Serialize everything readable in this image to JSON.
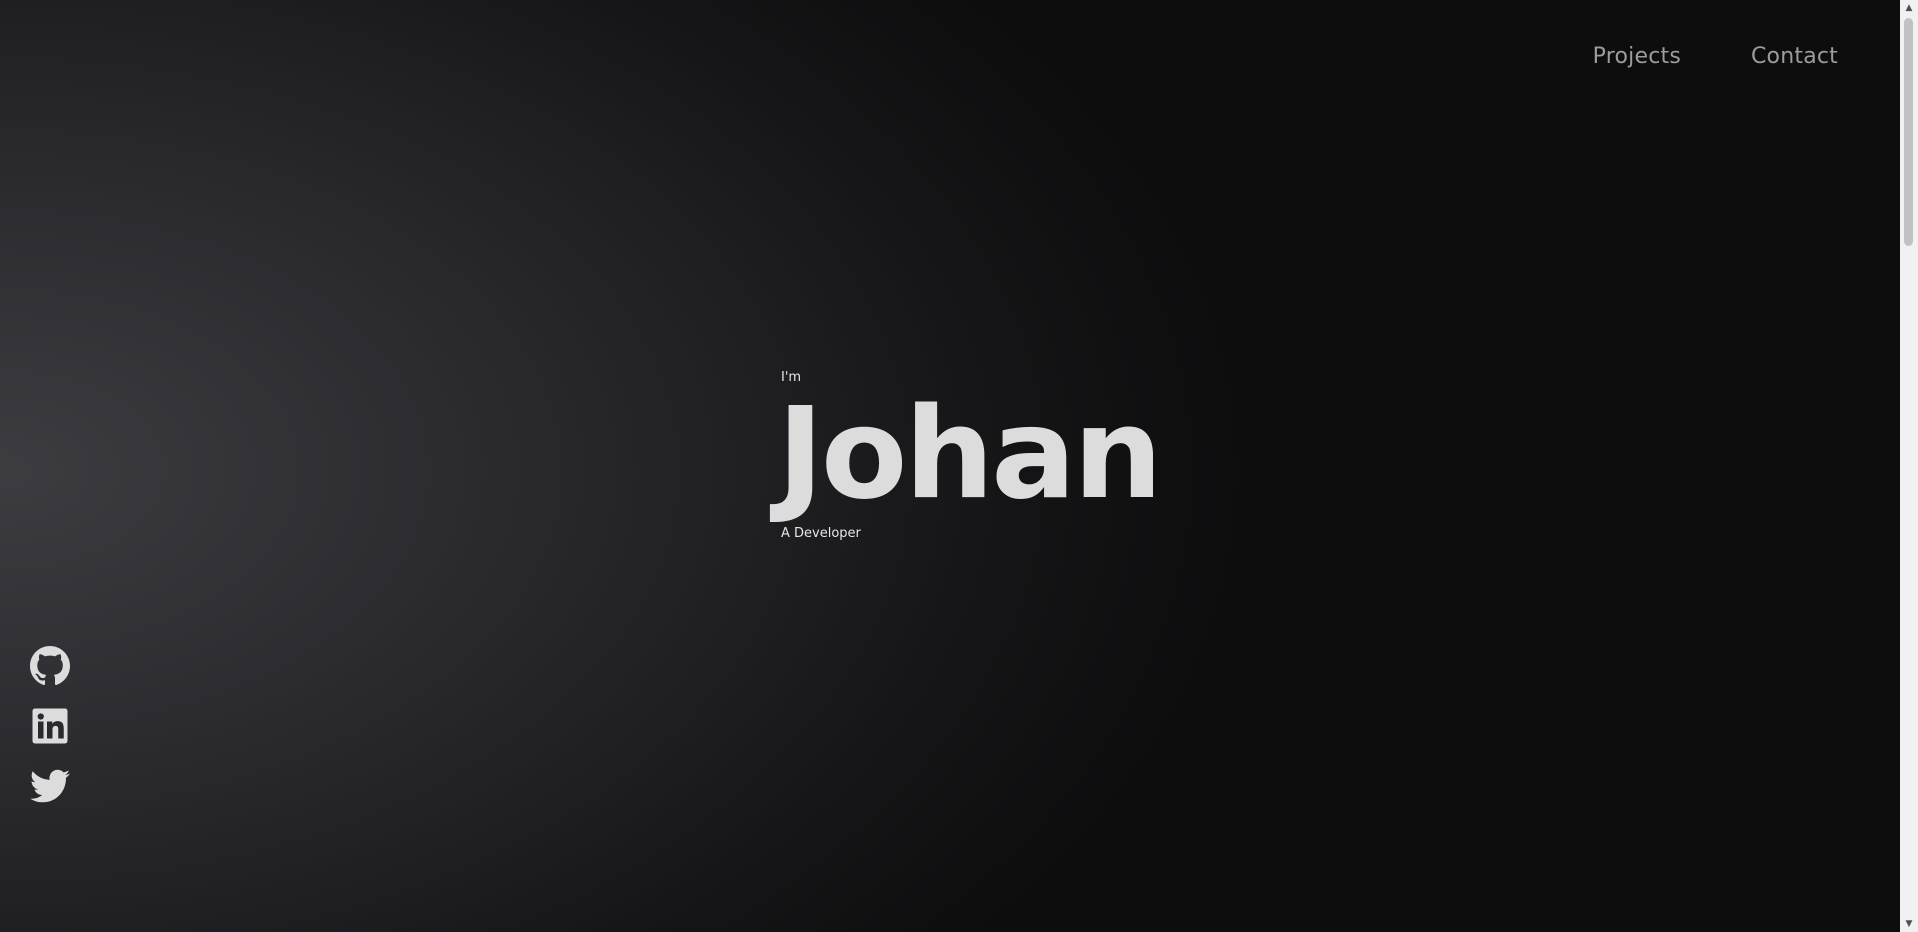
{
  "nav": {
    "projects_label": "Projects",
    "contact_label": "Contact"
  },
  "hero": {
    "intro": "I'm",
    "name": "Johan",
    "role": "A Developer"
  },
  "social": {
    "icons": [
      "github-icon",
      "linkedin-icon",
      "twitter-icon"
    ]
  },
  "colors": {
    "background": "#1c1c1f",
    "text": "#dcdcdc",
    "nav_text": "#9c9ca0"
  },
  "scrollbar": {
    "up_arrow": "▲",
    "down_arrow": "▼"
  }
}
